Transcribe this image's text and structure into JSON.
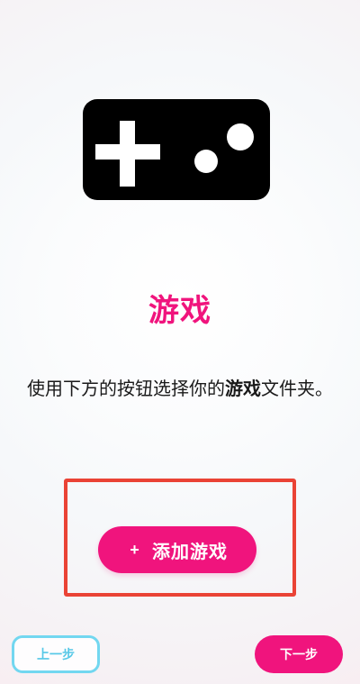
{
  "hero": {
    "icon": "game-controller-icon"
  },
  "content": {
    "title": "游戏",
    "description_part_1": "使用下方的按钮选择你的",
    "description_highlight": "游戏",
    "description_part_2": "文件夹。"
  },
  "actions": {
    "add_icon": "+",
    "add_label": "添加游戏",
    "previous_label": "上一步",
    "next_label": "下一步"
  },
  "colors": {
    "accent": "#f0147d",
    "highlight_box": "#ea4335",
    "secondary_outline": "#72d7f0",
    "secondary_text": "#56c8e7"
  }
}
